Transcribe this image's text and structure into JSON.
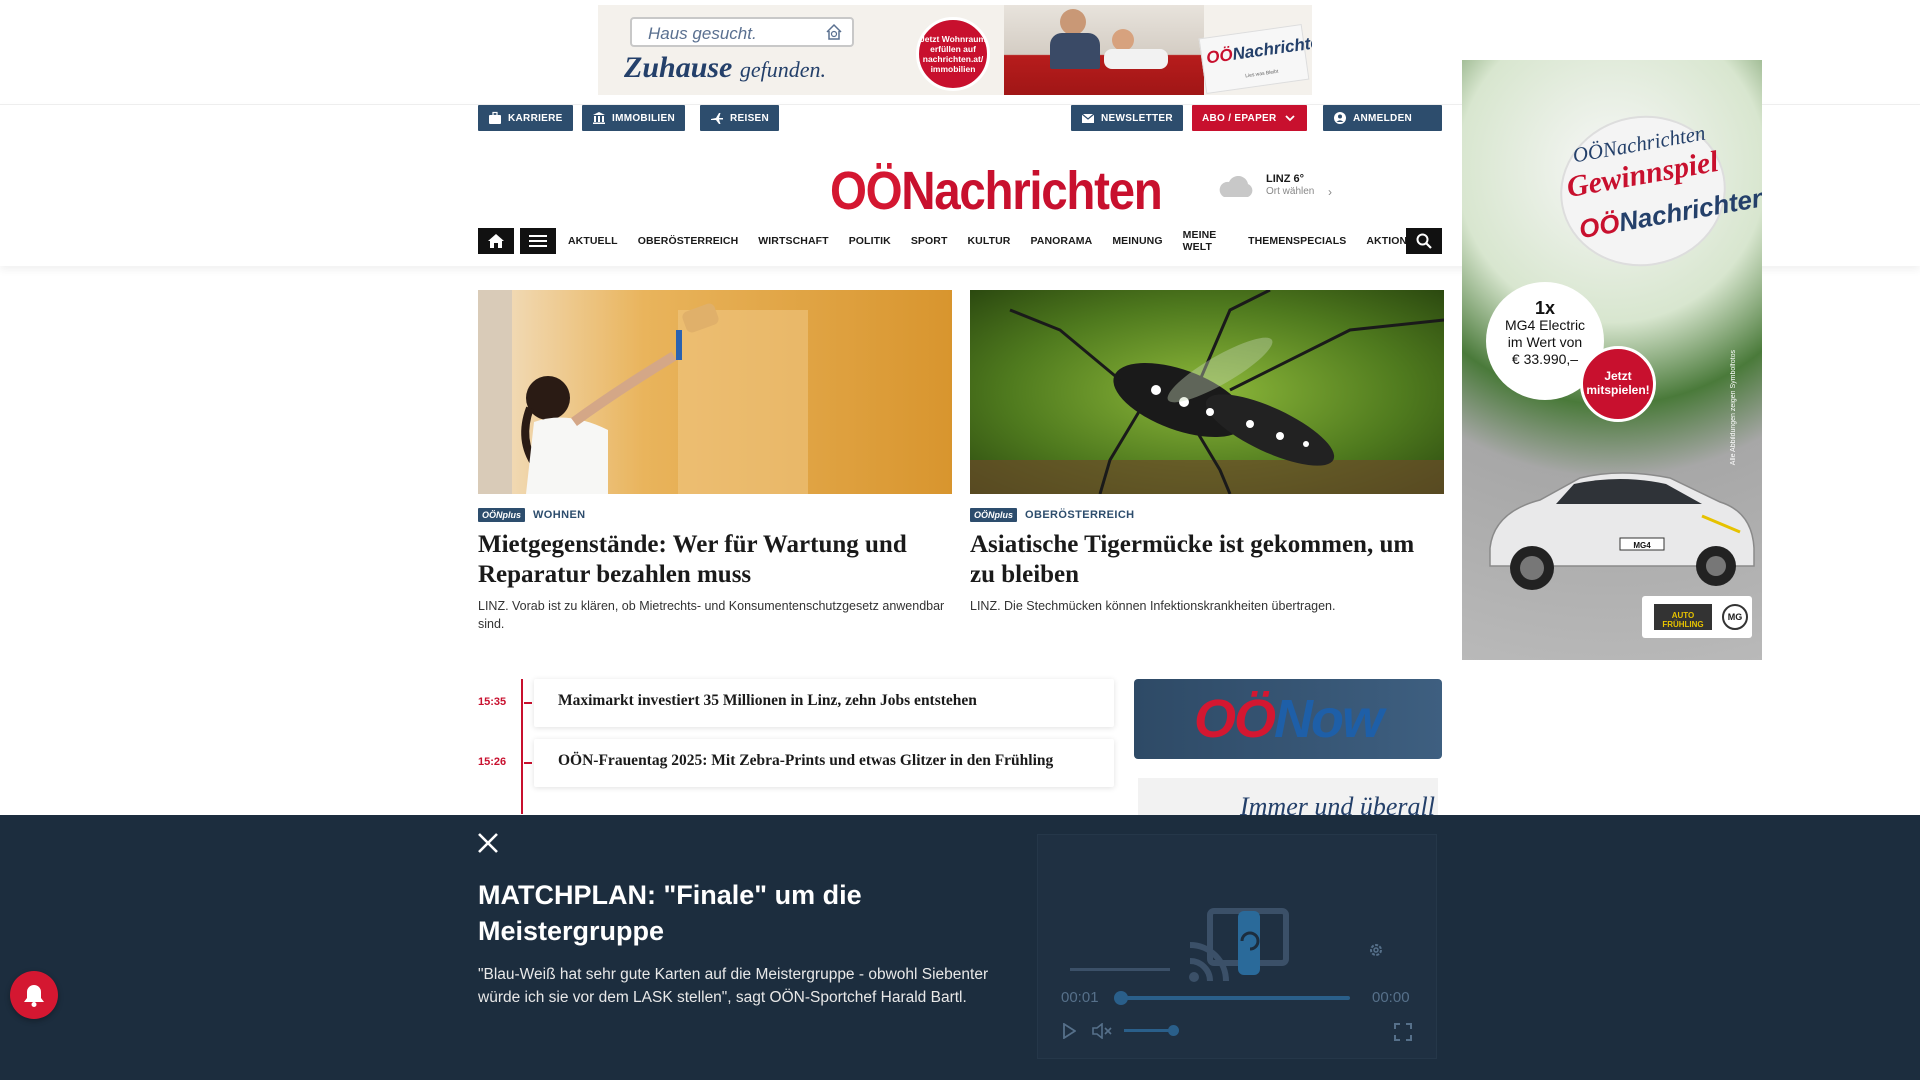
{
  "banner": {
    "search_text": "Haus gesucht.",
    "tagline_main": "Zuhause",
    "tagline_rest": "gefunden.",
    "badge_text": "Jetzt Wohnraum erfüllen auf nachrichten.at/ immobilien",
    "paper_logo_a": "OÖ",
    "paper_logo_b": "Nachrichten",
    "paper_small": "Lies was Bleibt"
  },
  "header": {
    "buttons_left": [
      {
        "label": "KARRIERE",
        "icon": "briefcase-icon"
      },
      {
        "label": "IMMOBILIEN",
        "icon": "building-icon"
      },
      {
        "label": "REISEN",
        "icon": "plane-icon"
      }
    ],
    "buttons_right": [
      {
        "label": "NEWSLETTER",
        "icon": "mail-icon"
      },
      {
        "label": "ABO / EPAPER",
        "icon": "chevron-down-icon"
      },
      {
        "label": "ANMELDEN",
        "icon": "user-icon"
      }
    ],
    "logo_oo": "OÖ",
    "logo_rest": "Nachrichten",
    "weather_city": "LINZ 6°",
    "weather_link": "Ort wählen",
    "accent": "#c8102e",
    "navy": "#2d4d6d"
  },
  "nav": {
    "items": [
      "AKTUELL",
      "OBERÖSTERREICH",
      "WIRTSCHAFT",
      "POLITIK",
      "SPORT",
      "KULTUR",
      "PANORAMA",
      "MEINUNG",
      "MEINE WELT",
      "THEMENSPECIALS",
      "AKTIONEN"
    ]
  },
  "articles": [
    {
      "badge": "OÖNplus",
      "category": "WOHNEN",
      "headline": "Mietgegenstände: Wer für Wartung und Reparatur bezahlen muss",
      "teaser": "LINZ. Vorab ist zu klären, ob Mietrechts- und Konsumentenschutzgesetz anwendbar sind."
    },
    {
      "badge": "OÖNplus",
      "category": "OBERÖSTERREICH",
      "headline": "Asiatische Tigermücke ist gekommen, um zu bleiben",
      "teaser": "LINZ. Die Stechmücken können Infektionskrankheiten übertragen."
    }
  ],
  "timeline": [
    {
      "time": "15:35",
      "title": "Maximarkt investiert 35 Millionen in Linz, zehn Jobs entstehen"
    },
    {
      "time": "15:26",
      "title": "OÖN-Frauentag 2025: Mit Zebra-Prints und etwas Glitzer in den Frühling"
    }
  ],
  "sidebar": {
    "oenow_a": "OÖ",
    "oenow_b": "Now",
    "immer": "Immer und überall"
  },
  "sky_ad": {
    "line1": "OÖNachrichten",
    "line2": "Gewinnspiel",
    "paper_a": "OÖ",
    "paper_b": "Nachrichten",
    "prize_big": "1x",
    "prize_l2": "MG4 Electric",
    "prize_l3": "im Wert von",
    "prize_l4": "€ 33.990,–",
    "cta": "Jetzt mitspielen!",
    "side_note": "Alle Abbildungen zeigen Symbolfotos",
    "plate": "MG4",
    "dealer": "AUTO FRÜHLING",
    "brand": "MG"
  },
  "overlay": {
    "title": "MATCHPLAN: \"Finale\" um die Meistergruppe",
    "text": "\"Blau-Weiß hat sehr gute Karten auf die Meistergruppe - obwohl Siebenter würde ich sie vor dem LASK stellen\", sagt OÖN-Sportchef Harald Bartl.",
    "time_current": "00:01",
    "time_total": "00:00"
  }
}
